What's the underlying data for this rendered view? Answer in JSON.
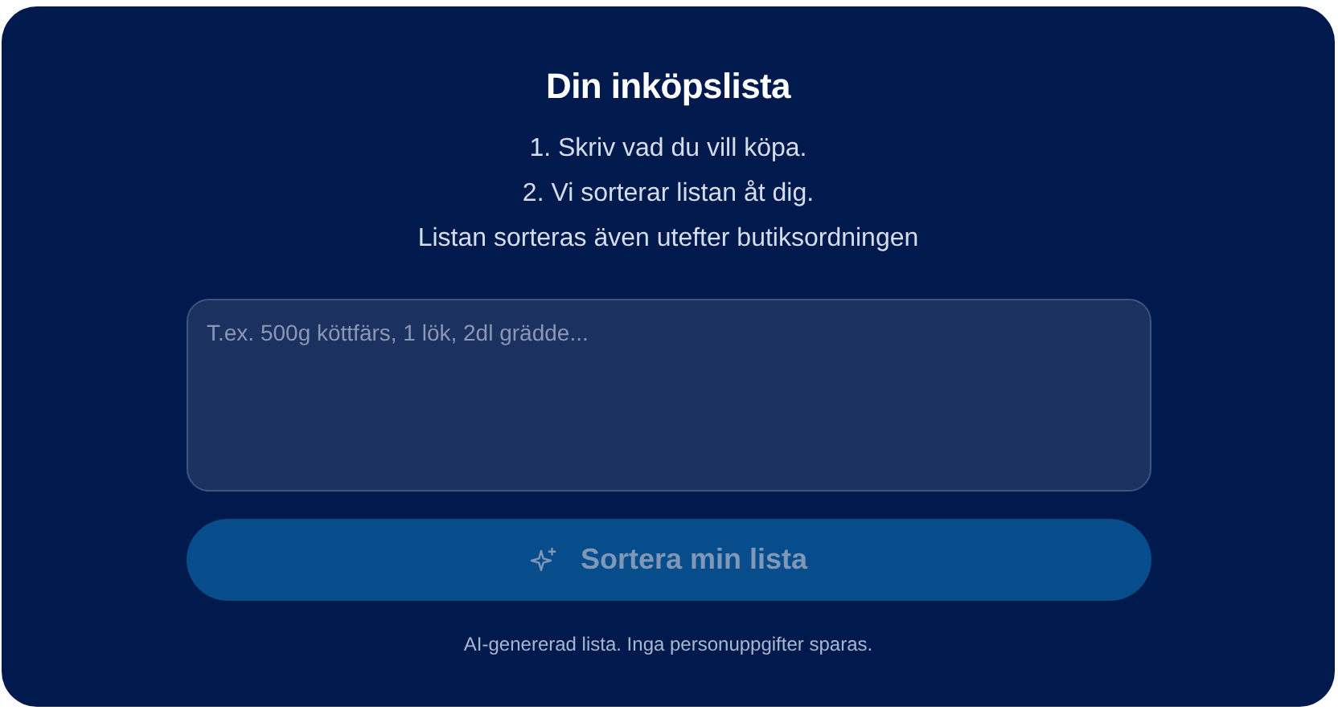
{
  "title": "Din inköpslista",
  "instructions": [
    "1. Skriv vad du vill köpa.",
    "2. Vi sorterar listan åt dig.",
    "Listan sorteras även utefter butiksordningen"
  ],
  "list_field": {
    "placeholder": "T.ex. 500g köttfärs, 1 lök, 2dl grädde..."
  },
  "sort_button": {
    "label": "Sortera min lista",
    "disabled": true
  },
  "footer": "AI-genererad lista. Inga personuppgifter sparas."
}
